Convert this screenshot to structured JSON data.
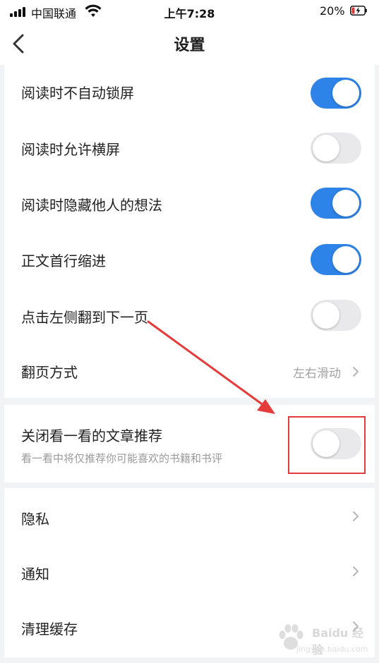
{
  "status_bar": {
    "carrier": "中国联通",
    "time": "上午7:28",
    "battery": "20%"
  },
  "nav": {
    "title": "设置",
    "back_icon": "chevron-left-icon"
  },
  "settings": {
    "reading_group": [
      {
        "label": "阅读时不自动锁屏",
        "toggle": true
      },
      {
        "label": "阅读时允许横屏",
        "toggle": false
      },
      {
        "label": "阅读时隐藏他人的想法",
        "toggle": true
      },
      {
        "label": "正文首行缩进",
        "toggle": true
      },
      {
        "label": "点击左侧翻到下一页",
        "toggle": false
      }
    ],
    "page_turn": {
      "label": "翻页方式",
      "value": "左右滑动"
    },
    "recommend": {
      "label": "关闭看一看的文章推荐",
      "sub": "看一看中将仅推荐你可能喜欢的书籍和书评",
      "toggle": false
    },
    "menu_group": [
      {
        "label": "隐私"
      },
      {
        "label": "通知"
      },
      {
        "label": "清理缓存"
      }
    ]
  },
  "annotation": {
    "color": "#e53b3b"
  },
  "watermark": {
    "brand": "Baidu 经验",
    "url": "jingyan.baidu.com"
  },
  "colors": {
    "toggle_on": "#2d83e8",
    "toggle_off": "#e9e9eb",
    "background": "#f2f3f5"
  }
}
